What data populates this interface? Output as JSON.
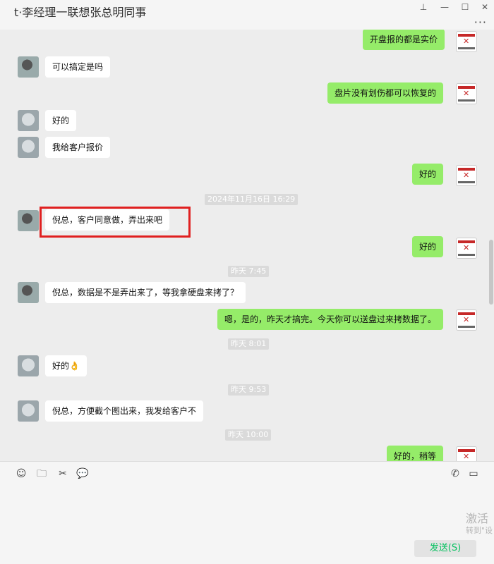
{
  "window": {
    "title": "t·李经理一联想张总明同事",
    "pin_icon": "pin-icon",
    "minimize_icon": "minimize-icon",
    "maximize_icon": "maximize-icon",
    "close_icon": "close-icon",
    "more_icon": "more-icon"
  },
  "messages": [
    {
      "side": "right",
      "text": "开盘报的都是实价"
    },
    {
      "side": "left",
      "text": "可以搞定是吗"
    },
    {
      "side": "right",
      "text": "盘片没有划伤都可以恢复的"
    },
    {
      "side": "left",
      "text": "好的"
    },
    {
      "side": "left",
      "text": "我给客户报价"
    },
    {
      "side": "right",
      "text": "好的"
    },
    {
      "time": "2024年11月16日 16:29"
    },
    {
      "side": "left",
      "text": "倪总，客户同意做，弄出来吧"
    },
    {
      "side": "right",
      "text": "好的"
    },
    {
      "time": "昨天 7:45"
    },
    {
      "side": "left",
      "text": "倪总，数据是不是弄出来了，等我拿硬盘来拷了？"
    },
    {
      "side": "right",
      "text": "嗯，是的，昨天才搞完。今天你可以送盘过来拷数据了。"
    },
    {
      "time": "昨天 8:01"
    },
    {
      "side": "left",
      "text": "好的👌"
    },
    {
      "time": "昨天 9:53"
    },
    {
      "side": "left",
      "text": "倪总，方便截个图出来，我发给客户不"
    },
    {
      "time": "昨天 10:00"
    },
    {
      "side": "right",
      "text": "好的，稍等"
    }
  ],
  "toolbar": {
    "emoji": "emoji-icon",
    "folder": "folder-icon",
    "scissors": "scissors-icon",
    "chat": "chat-history-icon",
    "phone": "phone-icon",
    "video": "video-icon"
  },
  "watermark": {
    "line1": "激活",
    "line2": "转到\"设"
  },
  "send_label": "发送(S)",
  "colors": {
    "right_bubble": "#95ec69",
    "left_bubble": "#ffffff",
    "highlight": "#e02020",
    "send_text": "#07c160"
  }
}
